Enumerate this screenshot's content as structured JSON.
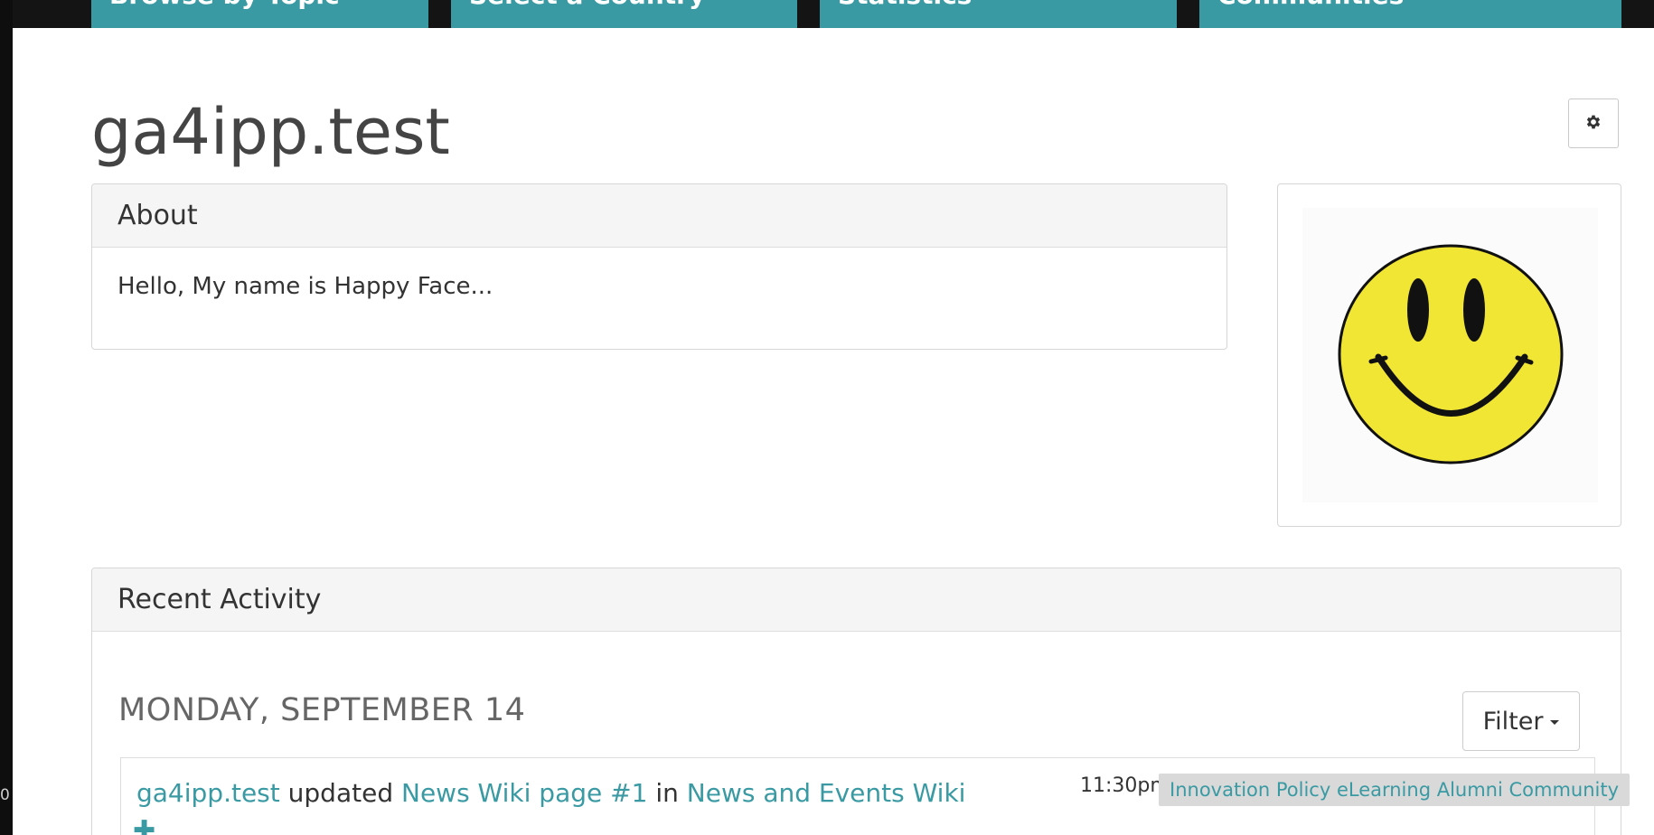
{
  "nav": {
    "tabs": [
      {
        "label": "Browse by Topic"
      },
      {
        "label": "Select a Country"
      },
      {
        "label": "Statistics"
      },
      {
        "label": "Communities"
      }
    ]
  },
  "left_strip_text": "0",
  "profile": {
    "title": "ga4ipp.test",
    "settings_icon": "gear-icon",
    "avatar_icon": "smiley-face"
  },
  "about": {
    "heading": "About",
    "body": "Hello, My name is Happy Face..."
  },
  "recent_activity": {
    "heading": "Recent Activity",
    "date": "MONDAY, SEPTEMBER 14",
    "filter_label": "Filter",
    "items": [
      {
        "actor": "ga4ipp.test",
        "verb": "updated",
        "object": "News Wiki page #1",
        "preposition": "in",
        "target": "News and Events Wiki",
        "time": "11:30pm",
        "community": "Innovation Policy eLearning Alumni Community",
        "expand_icon": "plus-icon"
      }
    ]
  },
  "colors": {
    "accent": "#3a9aa3",
    "nav_bg": "#141414",
    "panel_heading_bg": "#f5f5f5",
    "smiley_yellow": "#f2e635"
  }
}
